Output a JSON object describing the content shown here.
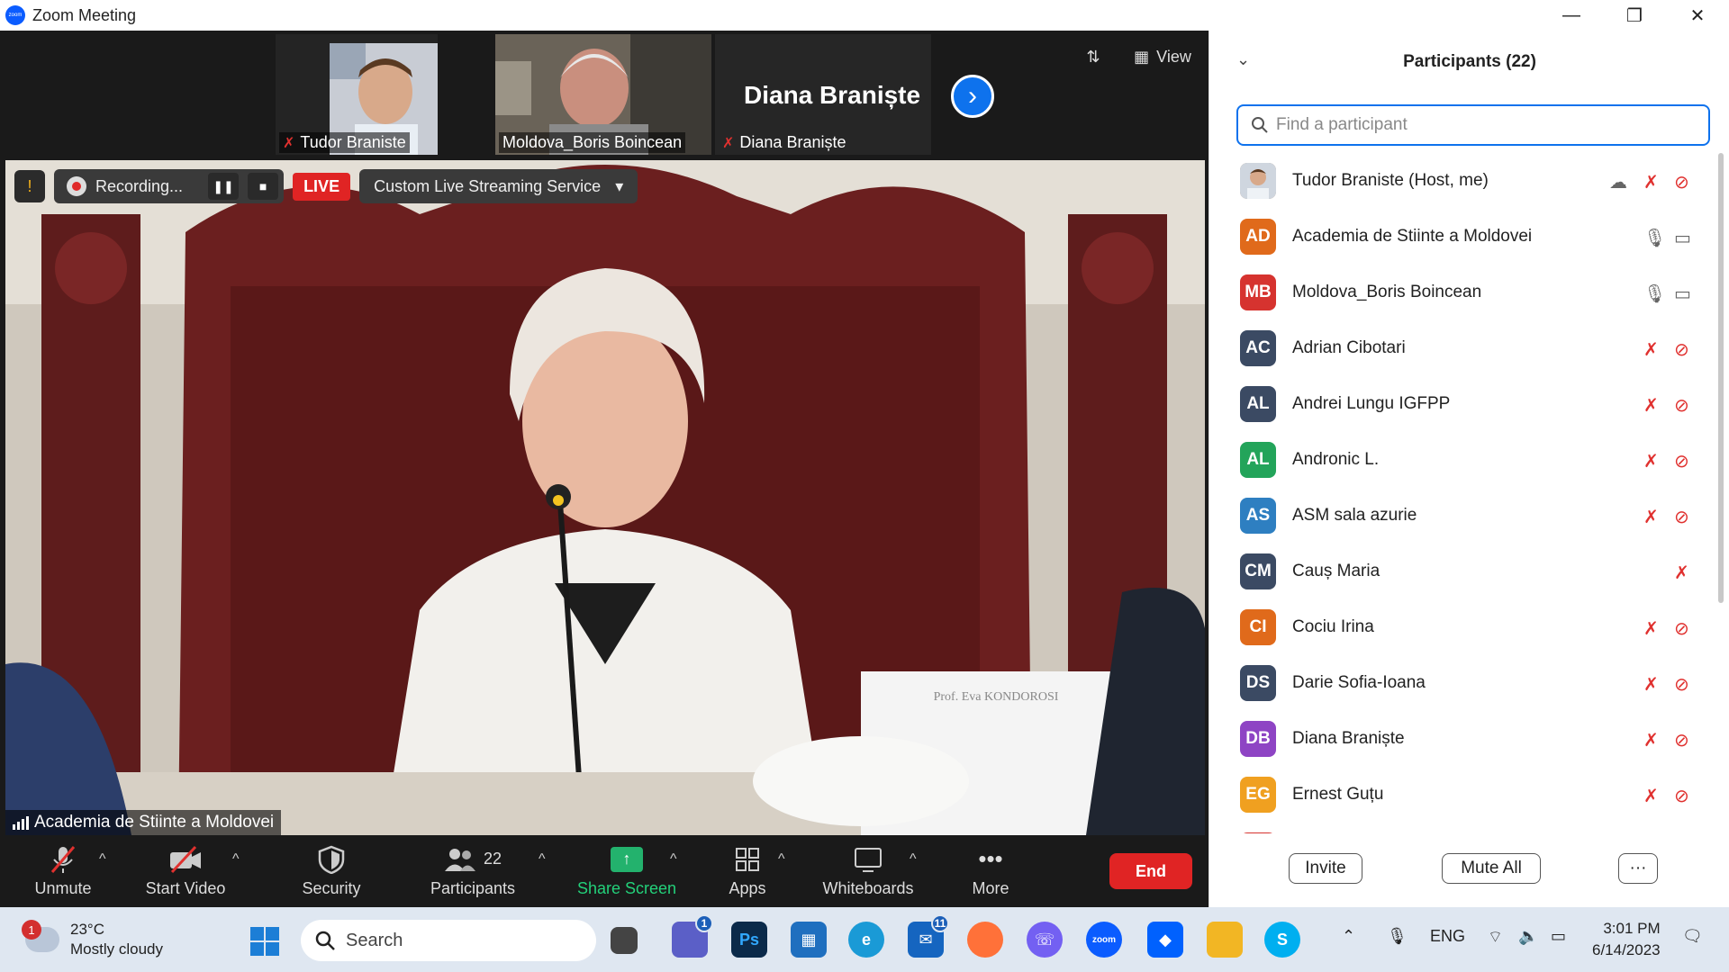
{
  "window": {
    "title": "Zoom Meeting",
    "minimize": "—",
    "maximize": "❐",
    "close": "✕"
  },
  "strip": {
    "thumbs": [
      {
        "name": "Tudor Braniste"
      },
      {
        "name": "Moldova_Boris Boincean"
      },
      {
        "name": "Diana Braniște"
      }
    ],
    "big_name": "Diana Braniște",
    "next_arrow": "›",
    "view_label": "View"
  },
  "recording": {
    "label": "Recording...",
    "pause": "❚❚",
    "stop": "■",
    "live": "LIVE",
    "service": "Custom Live Streaming Service",
    "service_caret": "▾"
  },
  "main_video": {
    "speaker": "Academia de Stiinte a Moldovei",
    "nameplate": "Prof. Eva KONDOROSI"
  },
  "toolbar": {
    "unmute": "Unmute",
    "start_video": "Start Video",
    "security": "Security",
    "participants": "Participants",
    "participants_count": "22",
    "share_screen": "Share Screen",
    "apps": "Apps",
    "whiteboards": "Whiteboards",
    "more": "More",
    "more_icon": "•••",
    "end": "End",
    "caret": "^"
  },
  "panel": {
    "title": "Participants (22)",
    "search_placeholder": "Find a participant",
    "participants": [
      {
        "name": "Tudor Braniste (Host, me)",
        "initials": "",
        "color": "#a8876a",
        "mic": "off",
        "video": "off",
        "cloud": true
      },
      {
        "name": "Academia de Stiinte a Moldovei",
        "initials": "AD",
        "color": "#e06a1b",
        "mic": "on",
        "video": "on"
      },
      {
        "name": "Moldova_Boris Boincean",
        "initials": "MB",
        "color": "#d6332f",
        "mic": "on",
        "video": "on"
      },
      {
        "name": "Adrian Cibotari",
        "initials": "AC",
        "color": "#3b4a63",
        "mic": "off",
        "video": "off"
      },
      {
        "name": "Andrei Lungu IGFPP",
        "initials": "AL",
        "color": "#3b4a63",
        "mic": "off",
        "video": "off"
      },
      {
        "name": "Andronic L.",
        "initials": "AL",
        "color": "#23a45a",
        "mic": "off",
        "video": "off"
      },
      {
        "name": "ASM sala azurie",
        "initials": "AS",
        "color": "#2e7fc1",
        "mic": "off",
        "video": "off"
      },
      {
        "name": "Cauș Maria",
        "initials": "CM",
        "color": "#3b4a63",
        "mic": "off",
        "video": "none"
      },
      {
        "name": "Cociu Irina",
        "initials": "CI",
        "color": "#e06a1b",
        "mic": "off",
        "video": "off"
      },
      {
        "name": "Darie Sofia-Ioana",
        "initials": "DS",
        "color": "#3b4a63",
        "mic": "off",
        "video": "off"
      },
      {
        "name": "Diana Braniște",
        "initials": "DB",
        "color": "#8e44c4",
        "mic": "off",
        "video": "off"
      },
      {
        "name": "Ernest Guțu",
        "initials": "EG",
        "color": "#f0a020",
        "mic": "off",
        "video": "off"
      }
    ],
    "invite": "Invite",
    "mute_all": "Mute All",
    "more": "···"
  },
  "taskbar": {
    "weather_temp": "23°C",
    "weather_desc": "Mostly cloudy",
    "weather_badge": "1",
    "search": "Search",
    "teams_badge": "1",
    "mail_badge": "11",
    "lang": "ENG",
    "time": "3:01 PM",
    "date": "6/14/2023",
    "apps": {
      "ps": "Ps",
      "zoom": "zoom",
      "skype": "S"
    }
  }
}
